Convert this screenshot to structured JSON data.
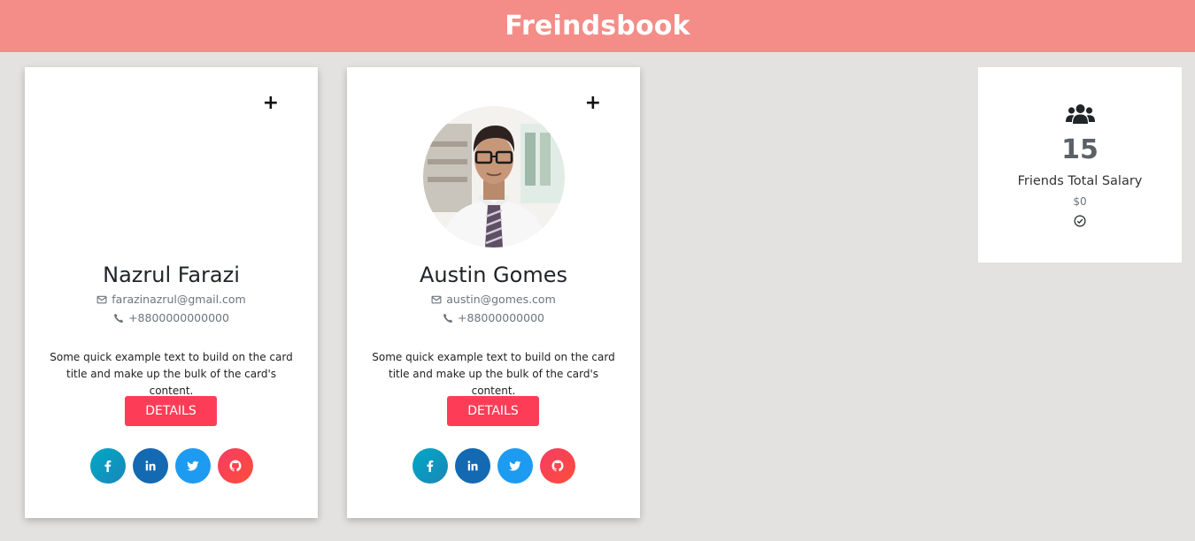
{
  "header": {
    "title": "Freindsbook"
  },
  "cards": [
    {
      "name": "Nazrul Farazi",
      "email": "farazinazrul@gmail.com",
      "phone": "+8800000000000",
      "description": "Some quick example text to build on the card title and make up the bulk of the card's content.",
      "details_label": "DETAILS",
      "add_symbol": "+",
      "has_photo": false
    },
    {
      "name": "Austin Gomes",
      "email": "austin@gomes.com",
      "phone": "+88000000000",
      "description": "Some quick example text to build on the card title and make up the bulk of the card's content.",
      "details_label": "DETAILS",
      "add_symbol": "+",
      "has_photo": true
    }
  ],
  "social_icons": [
    "facebook-icon",
    "linkedin-icon",
    "twitter-icon",
    "github-icon"
  ],
  "summary": {
    "icon": "users-icon",
    "count": "15",
    "label": "Friends Total Salary",
    "amount": "$0",
    "status_icon": "check-circle-icon"
  },
  "colors": {
    "header_bg": "#f48d88",
    "page_bg": "#e3e2e0",
    "details_button": "#fd3d57",
    "facebook": "#00a9c6",
    "linkedin": "#1369b2",
    "twitter": "#1d9bf0",
    "github": "#f43c64"
  }
}
